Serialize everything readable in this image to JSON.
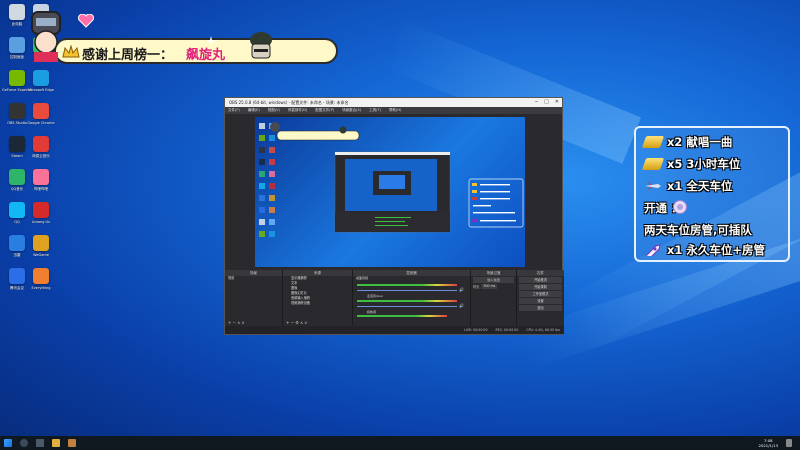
{
  "banner": {
    "text": "感谢上周榜一：",
    "name": "飙旋丸"
  },
  "gift_panel": {
    "rows": [
      {
        "icon": "gold-bar-icon",
        "text": "x2  献唱一曲",
        "color": "#f2c230"
      },
      {
        "icon": "gold-bar-icon",
        "text": "x5  3小时车位",
        "color": "#f2c230"
      },
      {
        "icon": "plane-icon",
        "text": "x1  全天车位",
        "color": "#c04040"
      },
      {
        "icon": "badge-icon",
        "text": "开通  ：",
        "color": "#c8b0e8"
      },
      {
        "icon": "",
        "text": "两天车位房管,可插队",
        "color": ""
      },
      {
        "icon": "rocket-icon",
        "text": "x1  永久车位+房管",
        "color": "#8030c0"
      }
    ]
  },
  "desktop_icons": [
    {
      "label": "此电脑",
      "color": "#d0d8e0"
    },
    {
      "label": "回收站",
      "color": "#c8d4e4"
    },
    {
      "label": "控制面板",
      "color": "#5aa0e0"
    },
    {
      "label": "微信",
      "color": "#2dc15a"
    },
    {
      "label": "GeForce Experience",
      "color": "#76b900"
    },
    {
      "label": "Microsoft Edge",
      "color": "#1b9de2"
    },
    {
      "label": "OBS Studio",
      "color": "#333333"
    },
    {
      "label": "Google Chrome",
      "color": "#e84b3c"
    },
    {
      "label": "Steam",
      "color": "#1b2838"
    },
    {
      "label": "网易云音乐",
      "color": "#e23b36"
    },
    {
      "label": "QQ音乐",
      "color": "#2fb56a"
    },
    {
      "label": "哔哩哔哩",
      "color": "#fb7299"
    },
    {
      "label": "QQ",
      "color": "#12b7f5"
    },
    {
      "label": "Among Us",
      "color": "#d42a2a"
    },
    {
      "label": "迅雷",
      "color": "#2a7de1"
    },
    {
      "label": "WeGame",
      "color": "#e0a020"
    },
    {
      "label": "腾讯会议",
      "color": "#2b6ee8"
    },
    {
      "label": "Everything",
      "color": "#f08030"
    }
  ],
  "obs": {
    "title": "OBS 25.0.8 (64-bit, windows) - 配置文件: 未命名 - 场景: 未命名",
    "menu": [
      "文件(F)",
      "编辑(E)",
      "视图(V)",
      "停靠部件(D)",
      "配置文件(P)",
      "场景集合(S)",
      "工具(T)",
      "帮助(H)"
    ],
    "docks": {
      "scenes_title": "场景",
      "scene_item": "场景",
      "sources_title": "来源",
      "sources": [
        "显示器捕获",
        "文本",
        "图像",
        "图像幻灯片",
        "音频输入捕获",
        "视频捕获设备"
      ],
      "mixer_title": "混音器",
      "mixer_tracks": [
        "桌面音频",
        "麦克风/Aux",
        "媒体源"
      ],
      "transitions_title": "场景过渡",
      "transition_value": "淡入淡出",
      "duration_label": "时长",
      "duration_value": "300 ms",
      "controls_title": "控件",
      "controls": [
        "开始推流",
        "开始录制",
        "工作室模式",
        "设置",
        "退出"
      ]
    },
    "status": [
      "LIVE: 00:00:00",
      "REC: 00:00:00",
      "CPU: 4.4%, 60.00 fps"
    ]
  },
  "taskbar": {
    "time": "7:08",
    "date": "2021/1/13"
  }
}
